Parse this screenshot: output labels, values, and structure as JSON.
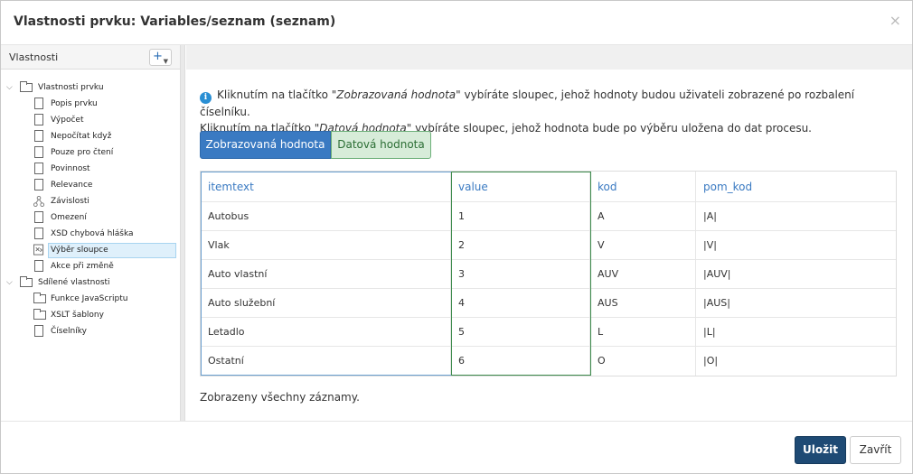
{
  "dialog": {
    "title": "Vlastnosti prvku: Variables/seznam (seznam)",
    "close_glyph": "×"
  },
  "sidebar": {
    "title": "Vlastnosti",
    "add_glyph": "+",
    "tree": [
      {
        "label": "Vlastnosti prvku",
        "icon": "folder-icon",
        "expanded": true
      },
      {
        "label": "Popis prvku",
        "icon": "file-icon"
      },
      {
        "label": "Výpočet",
        "icon": "file-icon"
      },
      {
        "label": "Nepočítat když",
        "icon": "file-icon"
      },
      {
        "label": "Pouze pro čtení",
        "icon": "file-icon"
      },
      {
        "label": "Povinnost",
        "icon": "file-icon"
      },
      {
        "label": "Relevance",
        "icon": "file-icon"
      },
      {
        "label": "Závislosti",
        "icon": "dependency-icon"
      },
      {
        "label": "Omezení",
        "icon": "file-icon"
      },
      {
        "label": "XSD chybová hláška",
        "icon": "file-icon"
      },
      {
        "label": "Výběr sloupce",
        "icon": "column-select-icon",
        "selected": true
      },
      {
        "label": "Akce při změně",
        "icon": "file-icon"
      },
      {
        "label": "Sdílené vlastnosti",
        "icon": "folder-icon",
        "expanded": true
      },
      {
        "label": "Funkce JavaScriptu",
        "icon": "folder-icon"
      },
      {
        "label": "XSLT šablony",
        "icon": "folder-icon"
      },
      {
        "label": "Číselníky",
        "icon": "file-icon"
      }
    ]
  },
  "main": {
    "info_line1_pre": "Kliknutím na tlačítko ",
    "info_line1_em": "\"Zobrazovaná hodnota\"",
    "info_line1_post": " vybíráte sloupec, jehož hodnoty budou uživateli zobrazené po rozbalení číselníku.",
    "info_line2_pre": "Kliknutím na tlačítko ",
    "info_line2_em": "\"Datová hodnota\"",
    "info_line2_post": " vybíráte sloupec, jehož hodnota bude po výběru uložena do dat procesu.",
    "tabs": [
      {
        "label": "Zobrazovaná hodnota",
        "active": true
      },
      {
        "label": "Datová hodnota",
        "active": false
      }
    ],
    "columns": [
      "itemtext",
      "value",
      "kod",
      "pom_kod"
    ],
    "rows": [
      [
        "Autobus",
        "1",
        "A",
        "|A|"
      ],
      [
        "Vlak",
        "2",
        "V",
        "|V|"
      ],
      [
        "Auto vlastní",
        "3",
        "AUV",
        "|AUV|"
      ],
      [
        "Auto služební",
        "4",
        "AUS",
        "|AUS|"
      ],
      [
        "Letadlo",
        "5",
        "L",
        "|L|"
      ],
      [
        "Ostatní",
        "6",
        "O",
        "|O|"
      ]
    ],
    "status": "Zobrazeny všechny záznamy."
  },
  "footer": {
    "save_label": "Uložit",
    "close_label": "Zavřít"
  },
  "colors": {
    "accent": "#3a7ac2",
    "save_button": "#1e4a74",
    "data_tab": "#d7ecd9"
  }
}
